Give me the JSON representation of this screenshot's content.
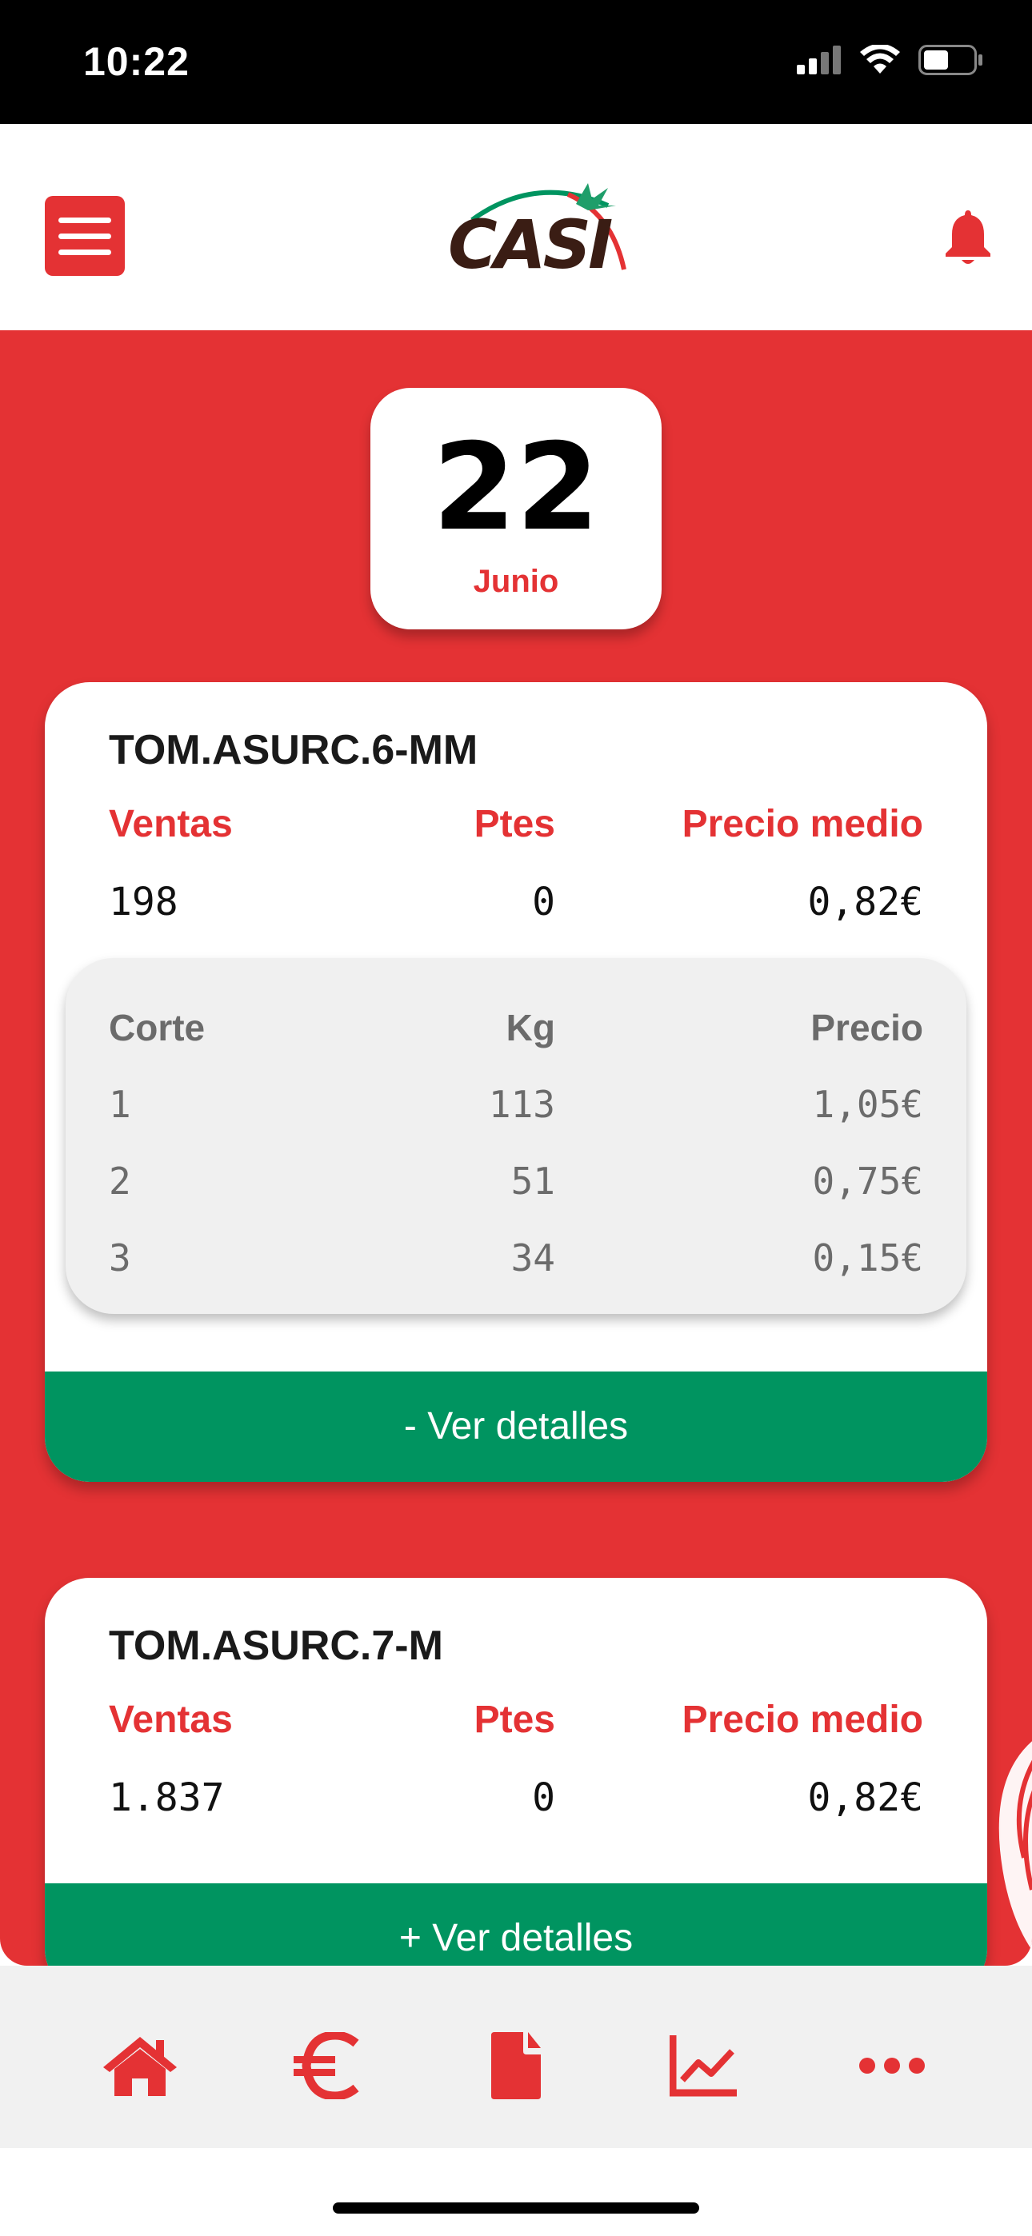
{
  "status_bar": {
    "time": "10:22"
  },
  "header": {
    "logo_text": "CASI"
  },
  "date": {
    "day": "22",
    "month": "Junio"
  },
  "colors": {
    "brand_red": "#e43234",
    "action_green": "#009460",
    "brown": "#3a1d14"
  },
  "products": [
    {
      "name": "TOM.ASURC.6-MM",
      "headers": {
        "sales": "Ventas",
        "pending": "Ptes",
        "avg_price": "Precio medio"
      },
      "values": {
        "sales": "198",
        "pending": "0",
        "avg_price": "0,82€"
      },
      "breakdown": {
        "headers": {
          "cut": "Corte",
          "kg": "Kg",
          "price": "Precio"
        },
        "rows": [
          {
            "cut": "1",
            "kg": "113",
            "price": "1,05€"
          },
          {
            "cut": "2",
            "kg": "51",
            "price": "0,75€"
          },
          {
            "cut": "3",
            "kg": "34",
            "price": "0,15€"
          }
        ]
      },
      "details_label": "- Ver detalles"
    },
    {
      "name": "TOM.ASURC.7-M",
      "headers": {
        "sales": "Ventas",
        "pending": "Ptes",
        "avg_price": "Precio medio"
      },
      "values": {
        "sales": "1.837",
        "pending": "0",
        "avg_price": "0,82€"
      },
      "details_label": "+ Ver detalles"
    }
  ],
  "tabbar": [
    {
      "icon": "home-icon"
    },
    {
      "icon": "euro-icon"
    },
    {
      "icon": "document-icon"
    },
    {
      "icon": "chart-line-icon"
    },
    {
      "icon": "more-icon"
    }
  ]
}
